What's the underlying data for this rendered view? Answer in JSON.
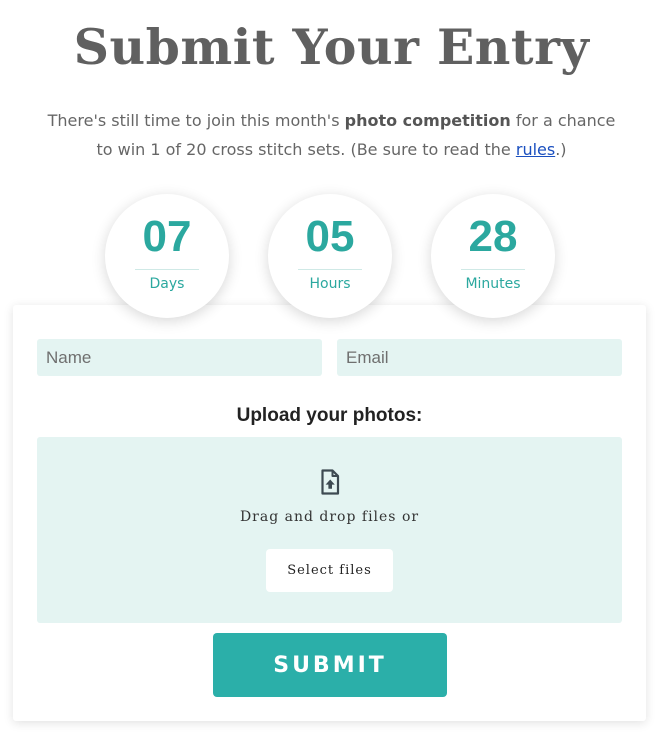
{
  "header": {
    "title": "Submit Your Entry"
  },
  "intro": {
    "text_before": "There's still time to join this month's ",
    "bold": "photo competition",
    "text_middle": " for a chance to win 1 of 20 cross stitch sets. (Be sure to read the ",
    "link": "rules",
    "text_after": ".)"
  },
  "countdown": [
    {
      "value": "07",
      "label": "Days"
    },
    {
      "value": "05",
      "label": "Hours"
    },
    {
      "value": "28",
      "label": "Minutes"
    }
  ],
  "form": {
    "name_placeholder": "Name",
    "email_placeholder": "Email",
    "upload_title": "Upload your photos:",
    "drop_text": "Drag and drop files or",
    "select_button": "Select files",
    "submit_button": "SUBMIT"
  },
  "icons": {
    "upload": "file-upload-icon"
  },
  "colors": {
    "accent": "#2bafa9",
    "field_bg": "#e4f4f2",
    "title": "#606060",
    "link": "#1a4fbf"
  }
}
